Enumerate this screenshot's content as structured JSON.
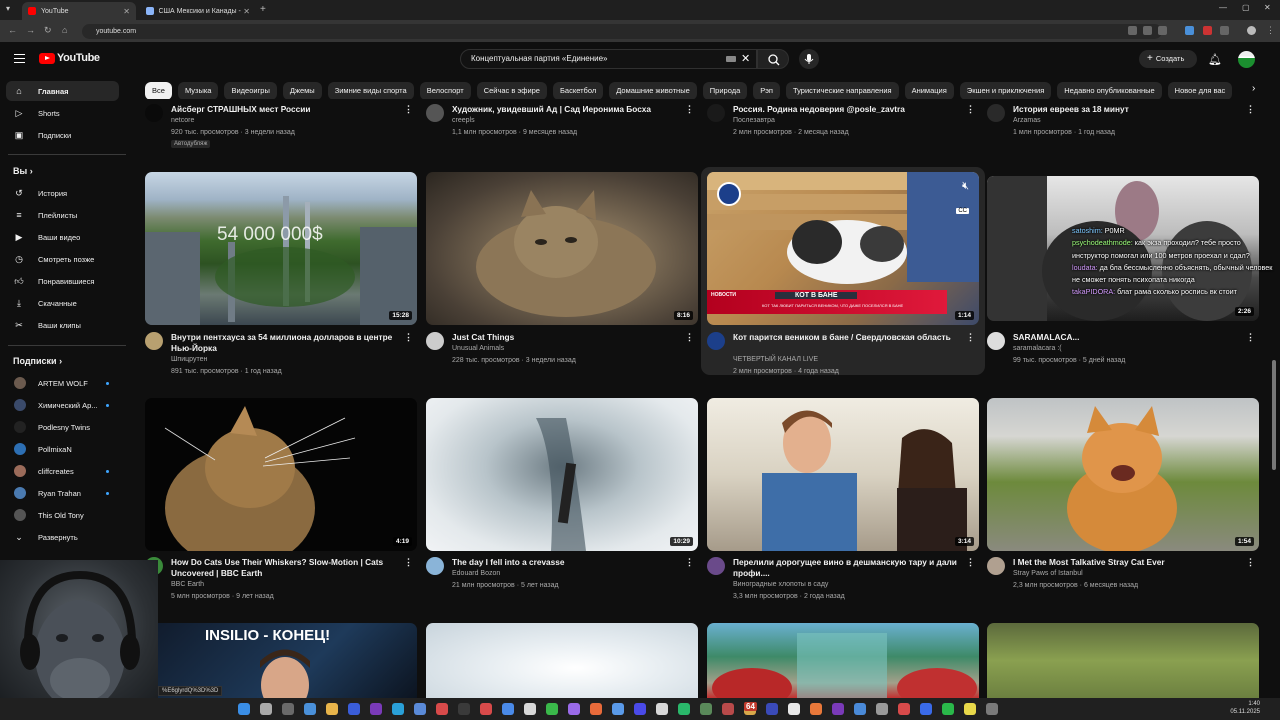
{
  "browser": {
    "tabs": [
      {
        "title": "YouTube",
        "active": true
      },
      {
        "title": "США Мексики и Канады - По..."
      }
    ],
    "url": "youtube.com"
  },
  "header": {
    "logo": "YouTube",
    "search_value": "Концептуальная партия «Единение»",
    "create_label": "Создать"
  },
  "chips": [
    "Все",
    "Музыка",
    "Видеоигры",
    "Джемы",
    "Зимние виды спорта",
    "Велоспорт",
    "Сейчас в эфире",
    "Баскетбол",
    "Домашние животные",
    "Природа",
    "Рэп",
    "Туристические направления",
    "Анимация",
    "Экшен и приключения",
    "Недавно опубликованные",
    "Новое для вас"
  ],
  "sidebar": {
    "main": [
      {
        "label": "Главная",
        "icon": "home-icon"
      },
      {
        "label": "Shorts",
        "icon": "shorts-icon"
      },
      {
        "label": "Подписки",
        "icon": "subscriptions-icon"
      }
    ],
    "you_header": "Вы",
    "you": [
      {
        "label": "История",
        "icon": "history-icon"
      },
      {
        "label": "Плейлисты",
        "icon": "playlists-icon"
      },
      {
        "label": "Ваши видео",
        "icon": "your-videos-icon"
      },
      {
        "label": "Смотреть позже",
        "icon": "watch-later-icon"
      },
      {
        "label": "Понравившиеся",
        "icon": "liked-icon"
      },
      {
        "label": "Скачанные",
        "icon": "downloads-icon"
      },
      {
        "label": "Ваши клипы",
        "icon": "clips-icon"
      }
    ],
    "subs_header": "Подписки",
    "subs": [
      {
        "label": "ARTEM WOLF",
        "color": "#6b5a4e"
      },
      {
        "label": "Химический Ар...",
        "color": "#3a4a6a"
      },
      {
        "label": "Podlesny Twins",
        "color": "#222222"
      },
      {
        "label": "PollmixaN",
        "color": "#2d6fb3"
      },
      {
        "label": "cliffcreates",
        "color": "#9b6b5a"
      },
      {
        "label": "Ryan Trahan",
        "color": "#4a7ab0"
      },
      {
        "label": "This Old Tony",
        "color": "#555555"
      }
    ],
    "expand_label": "Развернуть"
  },
  "top_row": [
    {
      "title": "Айсберг СТРАШНЫХ мест России",
      "channel": "netcore",
      "meta": "920 тыс. просмотров · 3 недели назад",
      "badge": "Автодубляж"
    },
    {
      "title": "Художник, увидевший Ад | Сад Иеронима Босха",
      "channel": "creepls",
      "meta": "1,1 млн просмотров · 9 месяцев назад"
    },
    {
      "title": "Россия. Родина недоверия @posle_zavtra",
      "channel": "Послезавтра",
      "meta": "2 млн просмотров · 2 месяца назад"
    },
    {
      "title": "История евреев за 18 минут",
      "channel": "Arzamas",
      "meta": "1 млн просмотров · 1 год назад"
    }
  ],
  "row1": [
    {
      "title": "Внутри пентхауса за 54 миллиона долларов в центре Нью-Йорка",
      "channel": "Шпицрутен",
      "meta": "891 тыс. просмотров · 1 год назад",
      "duration": "15:28",
      "overlay": "54 000 000$"
    },
    {
      "title": "Just Cat Things",
      "channel": "Unusual Animals",
      "meta": "228 тыс. просмотров · 3 недели назад",
      "duration": "8:16"
    },
    {
      "title": "Кот парится веником в бане / Свердловская область",
      "channel": "ЧЕТВЕРТЫЙ КАНАЛ LIVE",
      "meta": "2 млн просмотров · 4 года назад",
      "duration": "1:14",
      "banner": "КОТ В БАНЕ",
      "banner_sub": "КОТ ТАК ЛЮБИТ ПАРИТЬСЯ ВЕНИКОМ, ЧТО ДАЖЕ ПОСЕЛИЛСЯ В БАНЕ",
      "news_tag": "НОВОСТИ"
    },
    {
      "title": "SARAMALACA...",
      "channel": "saramalacara :(",
      "meta": "99 тыс. просмотров · 5 дней назад",
      "duration": "2:26"
    }
  ],
  "row2": [
    {
      "title": "How Do Cats Use Their Whiskers? Slow-Motion | Cats Uncovered | BBC Earth",
      "channel": "BBC Earth",
      "meta": "5 млн просмотров · 9 лет назад",
      "duration": "4:19"
    },
    {
      "title": "The day I fell into a crevasse",
      "channel": "Edouard Bozon",
      "meta": "21 млн просмотров · 5 лет назад",
      "duration": "10:29"
    },
    {
      "title": "Перелили дорогущее вино в дешманскую тару и дали профи....",
      "channel": "Виноградные хлопоты в саду",
      "meta": "3,3 млн просмотров · 2 года назад",
      "duration": "3:14"
    },
    {
      "title": "I Met the Most Talkative Stray Cat Ever",
      "channel": "Stray Paws of Istanbul",
      "meta": "2,3 млн просмотров · 6 месяцев назад",
      "duration": "1:54"
    }
  ],
  "row3_overlay": "INSILIO - КОНЕЦ!",
  "chat": [
    {
      "user": "satoshim:",
      "text": "P0MR",
      "cls": "u1"
    },
    {
      "user": "psychodeathmode:",
      "text": "как экза проходил? тебе просто инструктор помогал или 100 метров проехал и сдал?",
      "cls": "u2"
    },
    {
      "user": "loudata:",
      "text": "да бла бессмысленно объяснять, обычный человек не сможет понять психопата никогда",
      "cls": "u3"
    },
    {
      "user": "takaPIDORA:",
      "text": "блат рама сколько роспись вк стоит",
      "cls": "u3"
    }
  ],
  "status_url": "%E6glyrdQ%3D%3D",
  "taskbar_badge": "64",
  "clock": {
    "time": "1:40",
    "date": "05.11.2025"
  }
}
